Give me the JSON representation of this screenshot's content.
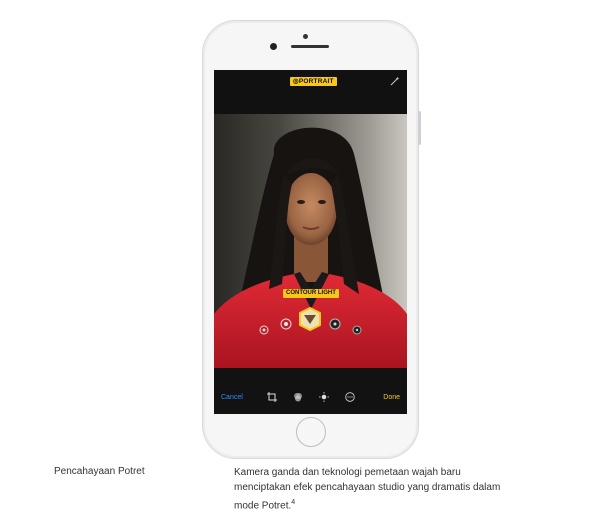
{
  "screen": {
    "top_badge": "PORTRAIT",
    "lighting_badge": "CONTOUR LIGHT",
    "toolbar": {
      "cancel_label": "Cancel",
      "done_label": "Done"
    }
  },
  "captions": {
    "title": "Pencahayaan Potret",
    "body": "Kamera ganda dan teknologi pemetaan wajah baru menciptakan efek pencahayaan studio yang dramatis dalam mode Potret.",
    "footnote": "4"
  },
  "colors": {
    "badge": "#f7c81b",
    "cancel": "#2f8cf5",
    "done": "#f7c81b",
    "jacket": "#d61f2c"
  },
  "icons": [
    "magic-wand-icon",
    "crop-icon",
    "filters-icon",
    "adjust-icon",
    "more-icon",
    "home-button"
  ]
}
